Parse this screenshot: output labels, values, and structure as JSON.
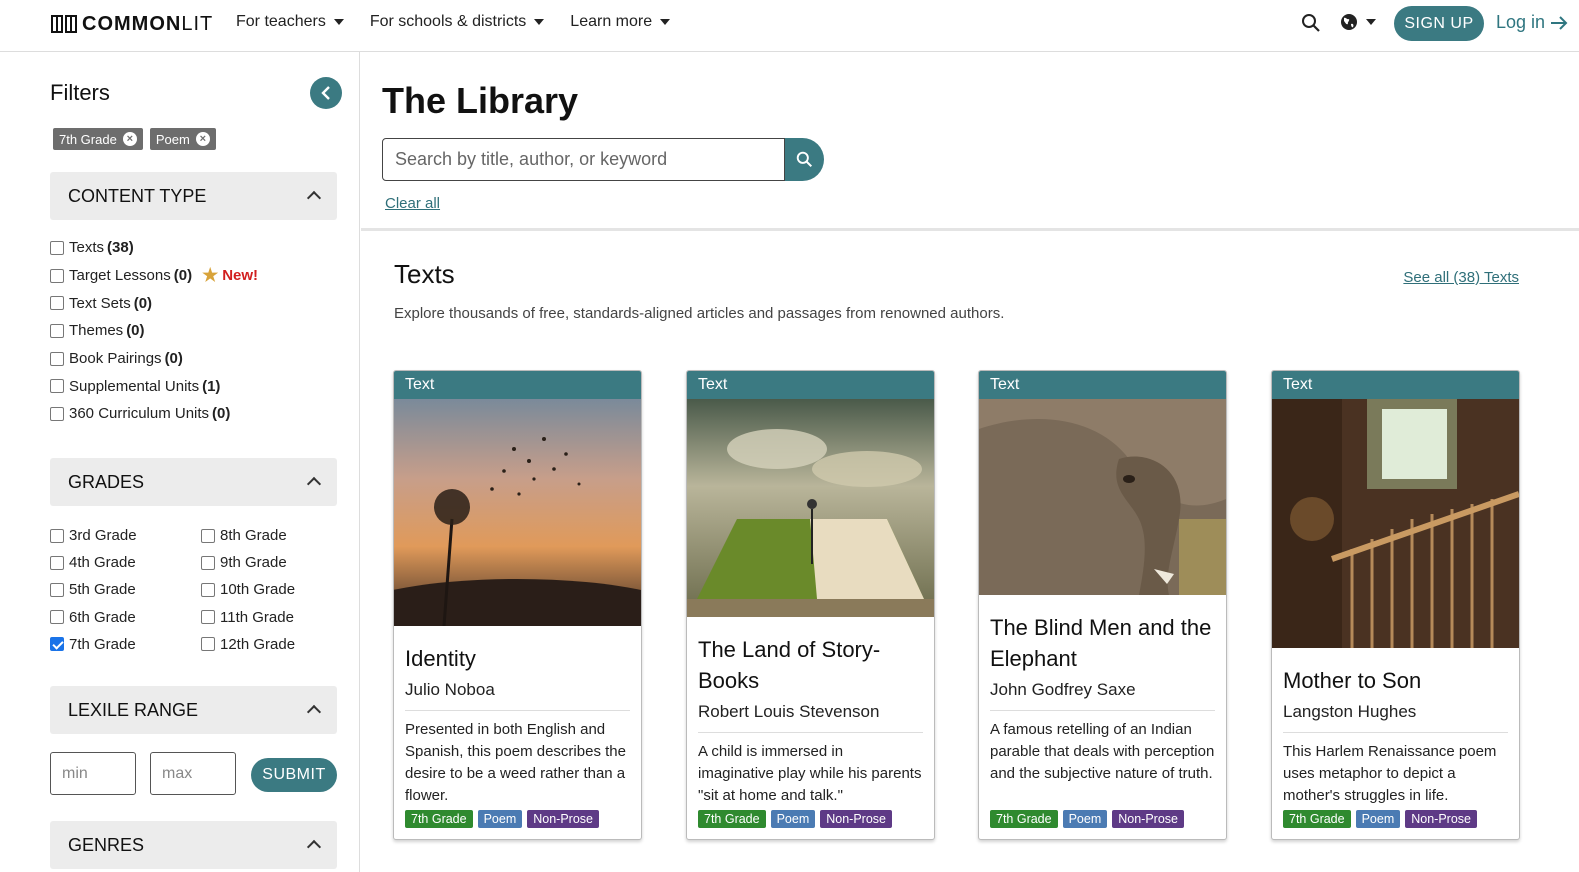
{
  "header": {
    "logo_bold": "COMMON",
    "logo_light": "LIT",
    "nav": [
      "For teachers",
      "For schools & districts",
      "Learn more"
    ],
    "signup_label": "SIGN UP",
    "login_label": "Log in"
  },
  "sidebar": {
    "title": "Filters",
    "chips": [
      "7th Grade",
      "Poem"
    ],
    "content_type": {
      "heading": "CONTENT TYPE",
      "items": [
        {
          "label": "Texts",
          "count": "(38)"
        },
        {
          "label": "Target Lessons",
          "count": "(0)",
          "badge": "New!"
        },
        {
          "label": "Text Sets",
          "count": "(0)"
        },
        {
          "label": "Themes",
          "count": "(0)"
        },
        {
          "label": "Book Pairings",
          "count": "(0)"
        },
        {
          "label": "Supplemental Units",
          "count": "(1)"
        },
        {
          "label": "360 Curriculum Units",
          "count": "(0)"
        }
      ]
    },
    "grades": {
      "heading": "GRADES",
      "items": [
        "3rd Grade",
        "8th Grade",
        "4th Grade",
        "9th Grade",
        "5th Grade",
        "10th Grade",
        "6th Grade",
        "11th Grade",
        "7th Grade",
        "12th Grade"
      ],
      "checked": "7th Grade"
    },
    "lexile": {
      "heading": "LEXILE RANGE",
      "min_placeholder": "min",
      "max_placeholder": "max",
      "submit_label": "SUBMIT"
    },
    "genres": {
      "heading": "GENRES"
    }
  },
  "main": {
    "title": "The Library",
    "search_placeholder": "Search by title, author, or keyword",
    "clear_all": "Clear all",
    "section_title": "Texts",
    "see_all": "See all (38) Texts",
    "description": "Explore thousands of free, standards-aligned articles and passages from renowned authors.",
    "cards": [
      {
        "label": "Text",
        "title": "Identity",
        "author": "Julio Noboa",
        "description": "Presented in both English and Spanish, this poem describes the desire to be a weed rather than a flower.",
        "tags": [
          "7th Grade",
          "Poem",
          "Non-Prose"
        ]
      },
      {
        "label": "Text",
        "title": "The Land of Story-Books",
        "author": "Robert Louis Stevenson",
        "description": "A child is immersed in imaginative play while his parents \"sit at home and talk.\"",
        "tags": [
          "7th Grade",
          "Poem",
          "Non-Prose"
        ]
      },
      {
        "label": "Text",
        "title": "The Blind Men and the Elephant",
        "author": "John Godfrey Saxe",
        "description": "A famous retelling of an Indian parable that deals with perception and the subjective nature of truth.",
        "tags": [
          "7th Grade",
          "Poem",
          "Non-Prose"
        ]
      },
      {
        "label": "Text",
        "title": "Mother to Son",
        "author": "Langston Hughes",
        "description": "This Harlem Renaissance poem uses metaphor to depict a mother's struggles in life.",
        "tags": [
          "7th Grade",
          "Poem",
          "Non-Prose"
        ]
      }
    ]
  },
  "colors": {
    "brand_teal": "#3b7a82",
    "tag_grade": "#2f8a2f",
    "tag_poem": "#4b7bb3",
    "tag_prose": "#5e3a86",
    "new_badge": "#d21f1f"
  }
}
